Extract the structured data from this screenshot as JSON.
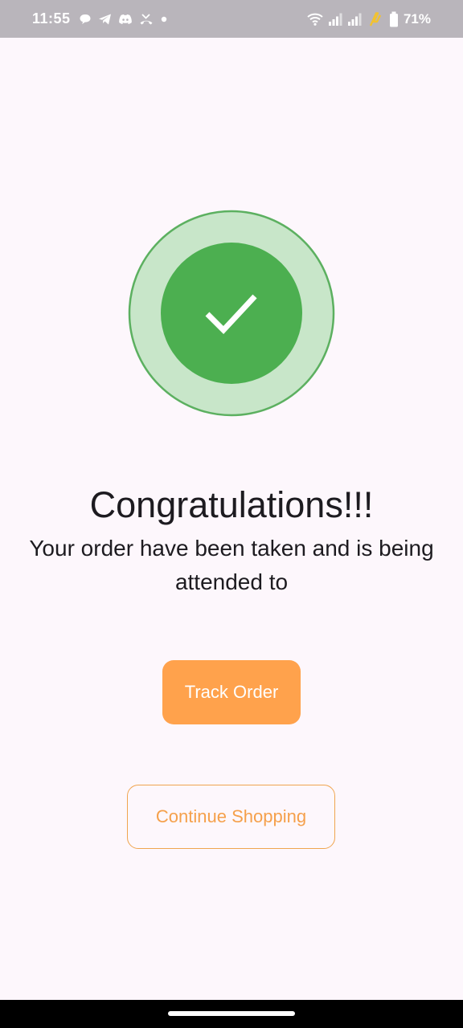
{
  "status_bar": {
    "time": "11:55",
    "battery_percent": "71%",
    "left_icons": [
      "chat-bubble-icon",
      "telegram-icon",
      "discord-icon",
      "missed-call-icon",
      "dot-icon"
    ],
    "right_icons": [
      "wifi-icon",
      "signal-icon",
      "signal-icon",
      "charging-icon",
      "battery-icon"
    ],
    "background_color": "#b9b5bb"
  },
  "success": {
    "icon": "check-icon",
    "outer_color": "#c8e6c9",
    "inner_color": "#4caf50",
    "title": "Congratulations!!!",
    "message": "Your order have been taken and is being attended to"
  },
  "actions": {
    "track_order_label": "Track Order",
    "continue_shopping_label": "Continue Shopping",
    "accent_color": "#ffa24c"
  }
}
